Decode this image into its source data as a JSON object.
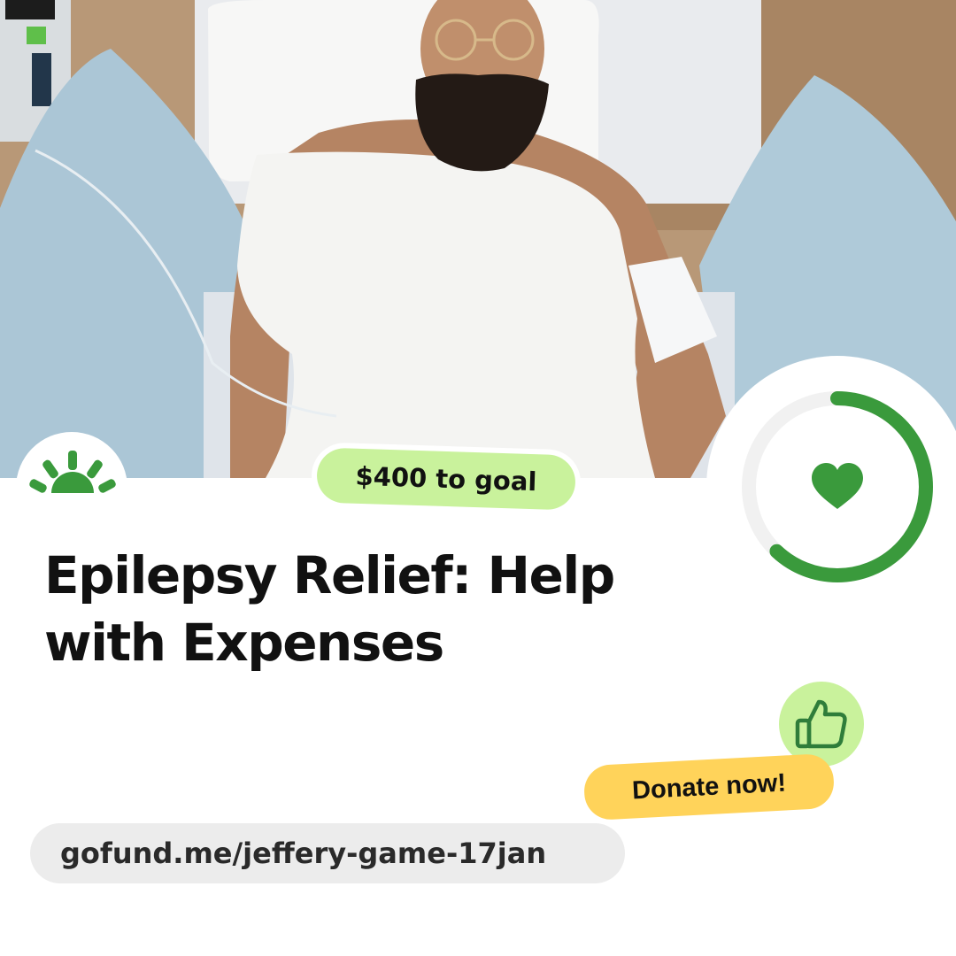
{
  "photo": {
    "icon": "fundraiser-photo"
  },
  "goal_badge": {
    "text": "$400 to goal"
  },
  "campaign": {
    "title": "Epilepsy Relief: Help with Expenses"
  },
  "progress_ring": {
    "fraction": 0.62,
    "icon": "heart-icon"
  },
  "donate_button": {
    "label": "Donate now!"
  },
  "thumb": {
    "icon": "thumbs-up-icon"
  },
  "link": {
    "url_text": "gofund.me/jeffery-game-17jan"
  },
  "colors": {
    "accent_green": "#3a9a3c",
    "light_green": "#c9f29c",
    "yellow": "#ffd35a",
    "pill_gray": "#ececec"
  }
}
